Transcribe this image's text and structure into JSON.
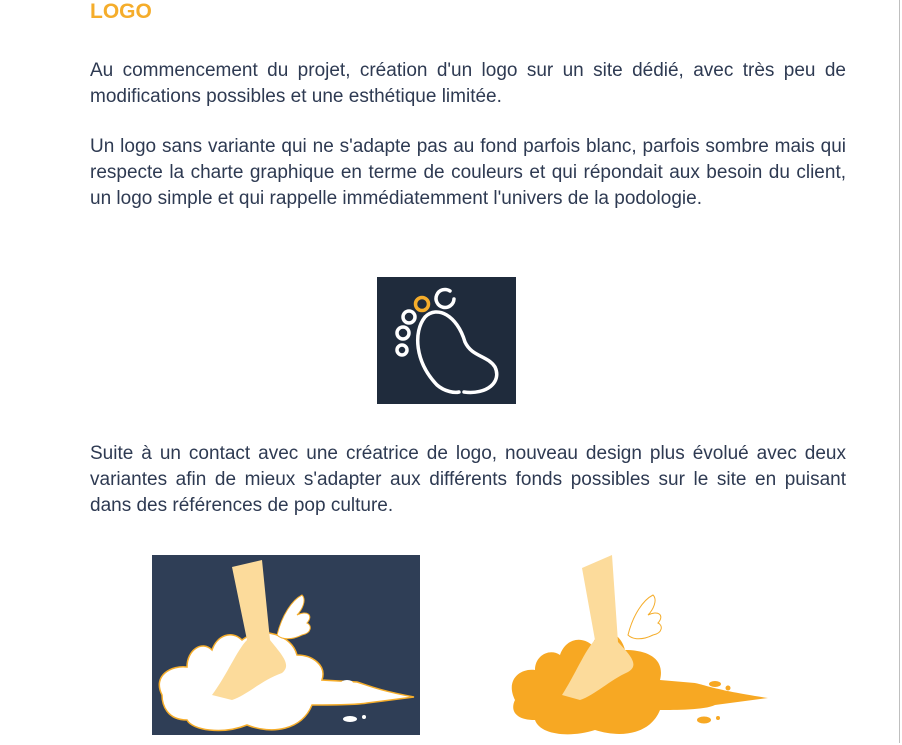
{
  "section": {
    "title": "LOGO",
    "paragraphs": [
      "Au commencement du projet, création d'un logo sur un site dédié, avec très peu de modifications possibles et une esthétique limitée.",
      "Un logo sans variante qui ne s'adapte pas au fond parfois blanc, parfois sombre mais qui respecte la charte graphique en terme de couleurs et qui répondait aux besoin du client, un logo simple et qui rappelle immédiatemment l'univers de la podologie.",
      "Suite à un contact avec une créatrice de logo, nouveau design plus évolué avec deux variantes afin de mieux s'adapter aux différents fonds possibles sur le site en puisant dans des références de pop culture."
    ]
  },
  "colors": {
    "accent": "#f5ad2b",
    "text": "#2e3a52",
    "dark_bg": "#1f2b3c",
    "navy_bg": "#2f3e56",
    "skin": "#fcdb9b",
    "cloud_orange": "#f7a823"
  }
}
